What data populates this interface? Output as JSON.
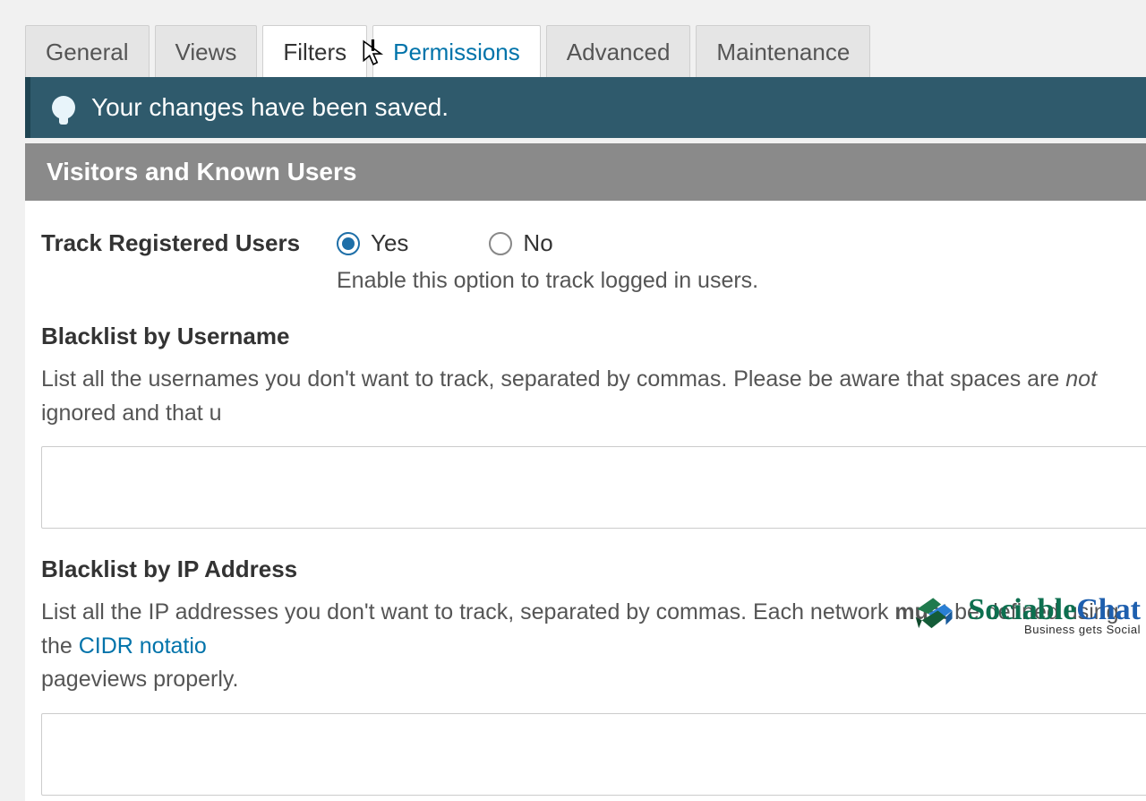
{
  "tabs": {
    "items": [
      {
        "label": "General"
      },
      {
        "label": "Views"
      },
      {
        "label": "Filters"
      },
      {
        "label": "Permissions"
      },
      {
        "label": "Advanced"
      },
      {
        "label": "Maintenance"
      }
    ]
  },
  "notice": {
    "text": "Your changes have been saved."
  },
  "section": {
    "title": "Visitors and Known Users"
  },
  "track_registered": {
    "label": "Track Registered Users",
    "yes": "Yes",
    "no": "No",
    "help": "Enable this option to track logged in users."
  },
  "blacklist_username": {
    "title": "Blacklist by Username",
    "desc_pre": "List all the usernames you don't want to track, separated by commas. Please be aware that spaces are ",
    "desc_em": "not",
    "desc_post": " ignored and that u",
    "value": ""
  },
  "blacklist_ip": {
    "title": "Blacklist by IP Address",
    "desc_pre": "List all the IP addresses you don't want to track, separated by commas. Each network ",
    "desc_strong": "must",
    "desc_mid": " be defined using the ",
    "desc_link": "CIDR notatio",
    "desc_tail": "pageviews properly.",
    "value": ""
  },
  "brand": {
    "name1": "Sociable",
    "name2": "Chat",
    "tagline": "Business gets Social"
  }
}
